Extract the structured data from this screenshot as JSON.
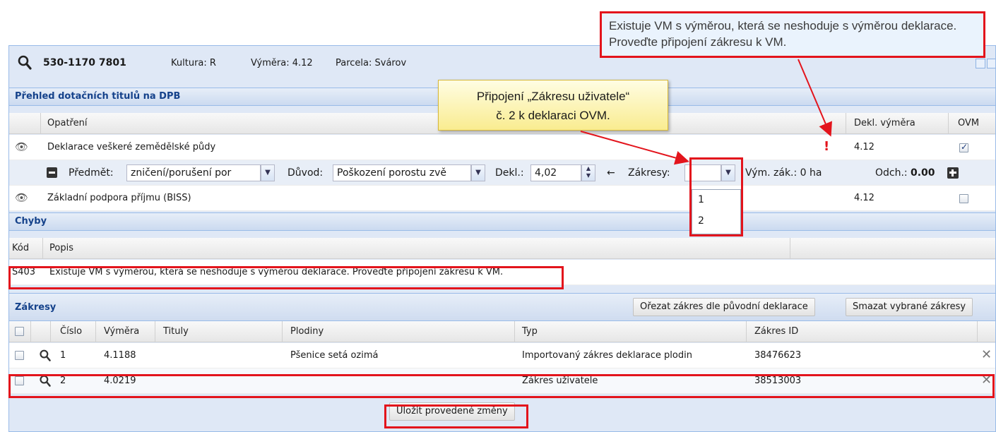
{
  "header": {
    "title": "530-1170 7801",
    "kultura": "Kultura: R",
    "vymera": "Výměra: 4.12",
    "parcela": "Parcela: Svárov"
  },
  "titles_section": {
    "title": "Přehled dotačních titulů na DPB",
    "columns": {
      "opatreni": "Opatření",
      "dekl_vymera": "Dekl. výměra",
      "ovm": "OVM"
    },
    "rows": [
      {
        "name": "Deklarace veškeré zemědělské půdy",
        "warning": "!",
        "dekl": "4.12",
        "ovm_checked": true
      },
      {
        "name": "Základní podpora příjmu (BISS)",
        "dekl": "4.12",
        "ovm_checked": false
      }
    ],
    "detail": {
      "predmet_label": "Předmět:",
      "predmet_value": "zničení/porušení por",
      "duvod_label": "Důvod:",
      "duvod_value": "Poškození porostu zvě",
      "dekl_label": "Dekl.:",
      "dekl_value": "4,02",
      "arrow": "←",
      "zakresy_label": "Zákresy:",
      "zakresy_value": "",
      "zakresy_options": [
        "1",
        "2"
      ],
      "vym_zak": "Vým. zák.: 0 ha",
      "odch_label": "Odch.:",
      "odch_value": "0.00"
    }
  },
  "errors_section": {
    "title": "Chyby",
    "columns": {
      "kod": "Kód",
      "popis": "Popis"
    },
    "rows": [
      {
        "kod": "S403",
        "popis": "Existuje VM s výměrou, která se neshoduje s výměrou deklarace. Proveďte připojení zákresu k VM."
      }
    ]
  },
  "drawings_section": {
    "title": "Zákresy",
    "buttons": {
      "trim": "Ořezat zákres dle původní deklarace",
      "delete": "Smazat vybrané zákresy"
    },
    "columns": {
      "cislo": "Číslo",
      "vymera": "Výměra",
      "tituly": "Tituly",
      "plodiny": "Plodiny",
      "typ": "Typ",
      "zakres_id": "Zákres ID"
    },
    "rows": [
      {
        "cislo": "1",
        "vymera": "4.1188",
        "tituly": "",
        "plodiny": "Pšenice setá ozimá",
        "typ": "Importovaný zákres deklarace plodin",
        "zakres_id": "38476623"
      },
      {
        "cislo": "2",
        "vymera": "4.0219",
        "tituly": "",
        "plodiny": "",
        "typ": "Zákres uživatele",
        "zakres_id": "38513003"
      }
    ]
  },
  "save_button": "Uložit provedené změny",
  "annotations": {
    "yellow_line1": "Připojení „Zákresu uživatele“",
    "yellow_line2": "č. 2 k deklaraci OVM.",
    "blue_text": "Existuje VM s výměrou, která se neshoduje s výměrou deklarace. Proveďte připojení zákresu k VM."
  },
  "colors": {
    "accent": "#15428b",
    "highlight": "#e3141c",
    "panel": "#dfe8f6"
  }
}
